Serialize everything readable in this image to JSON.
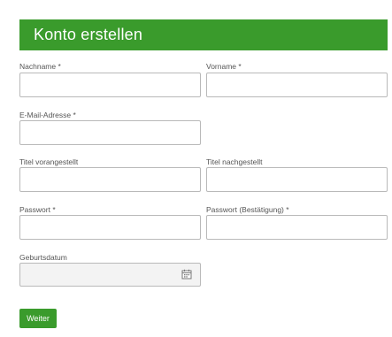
{
  "header": {
    "title": "Konto erstellen"
  },
  "fields": {
    "lastname": {
      "label": "Nachname *",
      "value": ""
    },
    "firstname": {
      "label": "Vorname *",
      "value": ""
    },
    "email": {
      "label": "E-Mail-Adresse *",
      "value": ""
    },
    "title_prefix": {
      "label": "Titel vorangestellt",
      "value": ""
    },
    "title_suffix": {
      "label": "Titel nachgestellt",
      "value": ""
    },
    "password": {
      "label": "Passwort *",
      "value": ""
    },
    "password_confirm": {
      "label": "Passwort (Bestätigung) *",
      "value": ""
    },
    "birthdate": {
      "label": "Geburtsdatum",
      "value": ""
    }
  },
  "actions": {
    "continue_label": "Weiter"
  },
  "icons": {
    "date_picker": "calendar-icon"
  },
  "colors": {
    "accent": "#3a9b2c",
    "input_border": "#b9b9b9",
    "disabled_input_bg": "#f3f3f3",
    "label_text": "#555555"
  }
}
